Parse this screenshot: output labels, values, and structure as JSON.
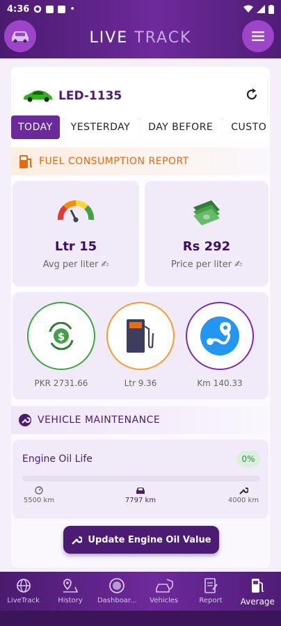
{
  "status_bar": {
    "time": "4:36"
  },
  "app": {
    "title_left": "LIVE",
    "title_right": "TRACK"
  },
  "vehicle": {
    "name": "LED-1135"
  },
  "tabs": [
    {
      "label": "TODAY"
    },
    {
      "label": "YESTERDAY"
    },
    {
      "label": "DAY BEFORE"
    },
    {
      "label": "CUSTO"
    }
  ],
  "fuel_report": {
    "title": "FUEL CONSUMPTION REPORT",
    "avg": {
      "value": "Ltr 15",
      "label": "Avg per liter ✍"
    },
    "price": {
      "value": "Rs 292",
      "label": "Price per liter ✍"
    },
    "totals": [
      {
        "value": "PKR 2731.66",
        "icon": "money-cycle-icon",
        "color": "#3aa63f"
      },
      {
        "value": "Ltr 9.36",
        "icon": "fuel-pump-icon",
        "color": "#f39c2f"
      },
      {
        "value": "Km 140.33",
        "icon": "route-icon",
        "color": "#7a2ab0"
      }
    ]
  },
  "maintenance": {
    "title": "VEHICLE MAINTENANCE",
    "oil_life_label": "Engine Oil Life",
    "oil_life_percent": "0%",
    "oil_life_fraction": 0.0,
    "points": [
      {
        "value": "5500 km",
        "icon": "speedometer-icon"
      },
      {
        "value": "7797 km",
        "icon": "car-icon"
      },
      {
        "value": "4000 km",
        "icon": "wrench-icon"
      }
    ],
    "update_button": "Update Engine Oil Value"
  },
  "nav": [
    {
      "label": "LiveTrack",
      "icon": "globe-icon"
    },
    {
      "label": "History",
      "icon": "map-pin-icon"
    },
    {
      "label": "Dashboar...",
      "icon": "dashboard-icon"
    },
    {
      "label": "Vehicles",
      "icon": "vehicles-icon"
    },
    {
      "label": "Report",
      "icon": "report-icon"
    },
    {
      "label": "Average",
      "icon": "fuel-pump-icon"
    }
  ],
  "colors": {
    "primary": "#4b1c72",
    "accent": "#9d45c9",
    "fuel_header": "#e36b10"
  }
}
